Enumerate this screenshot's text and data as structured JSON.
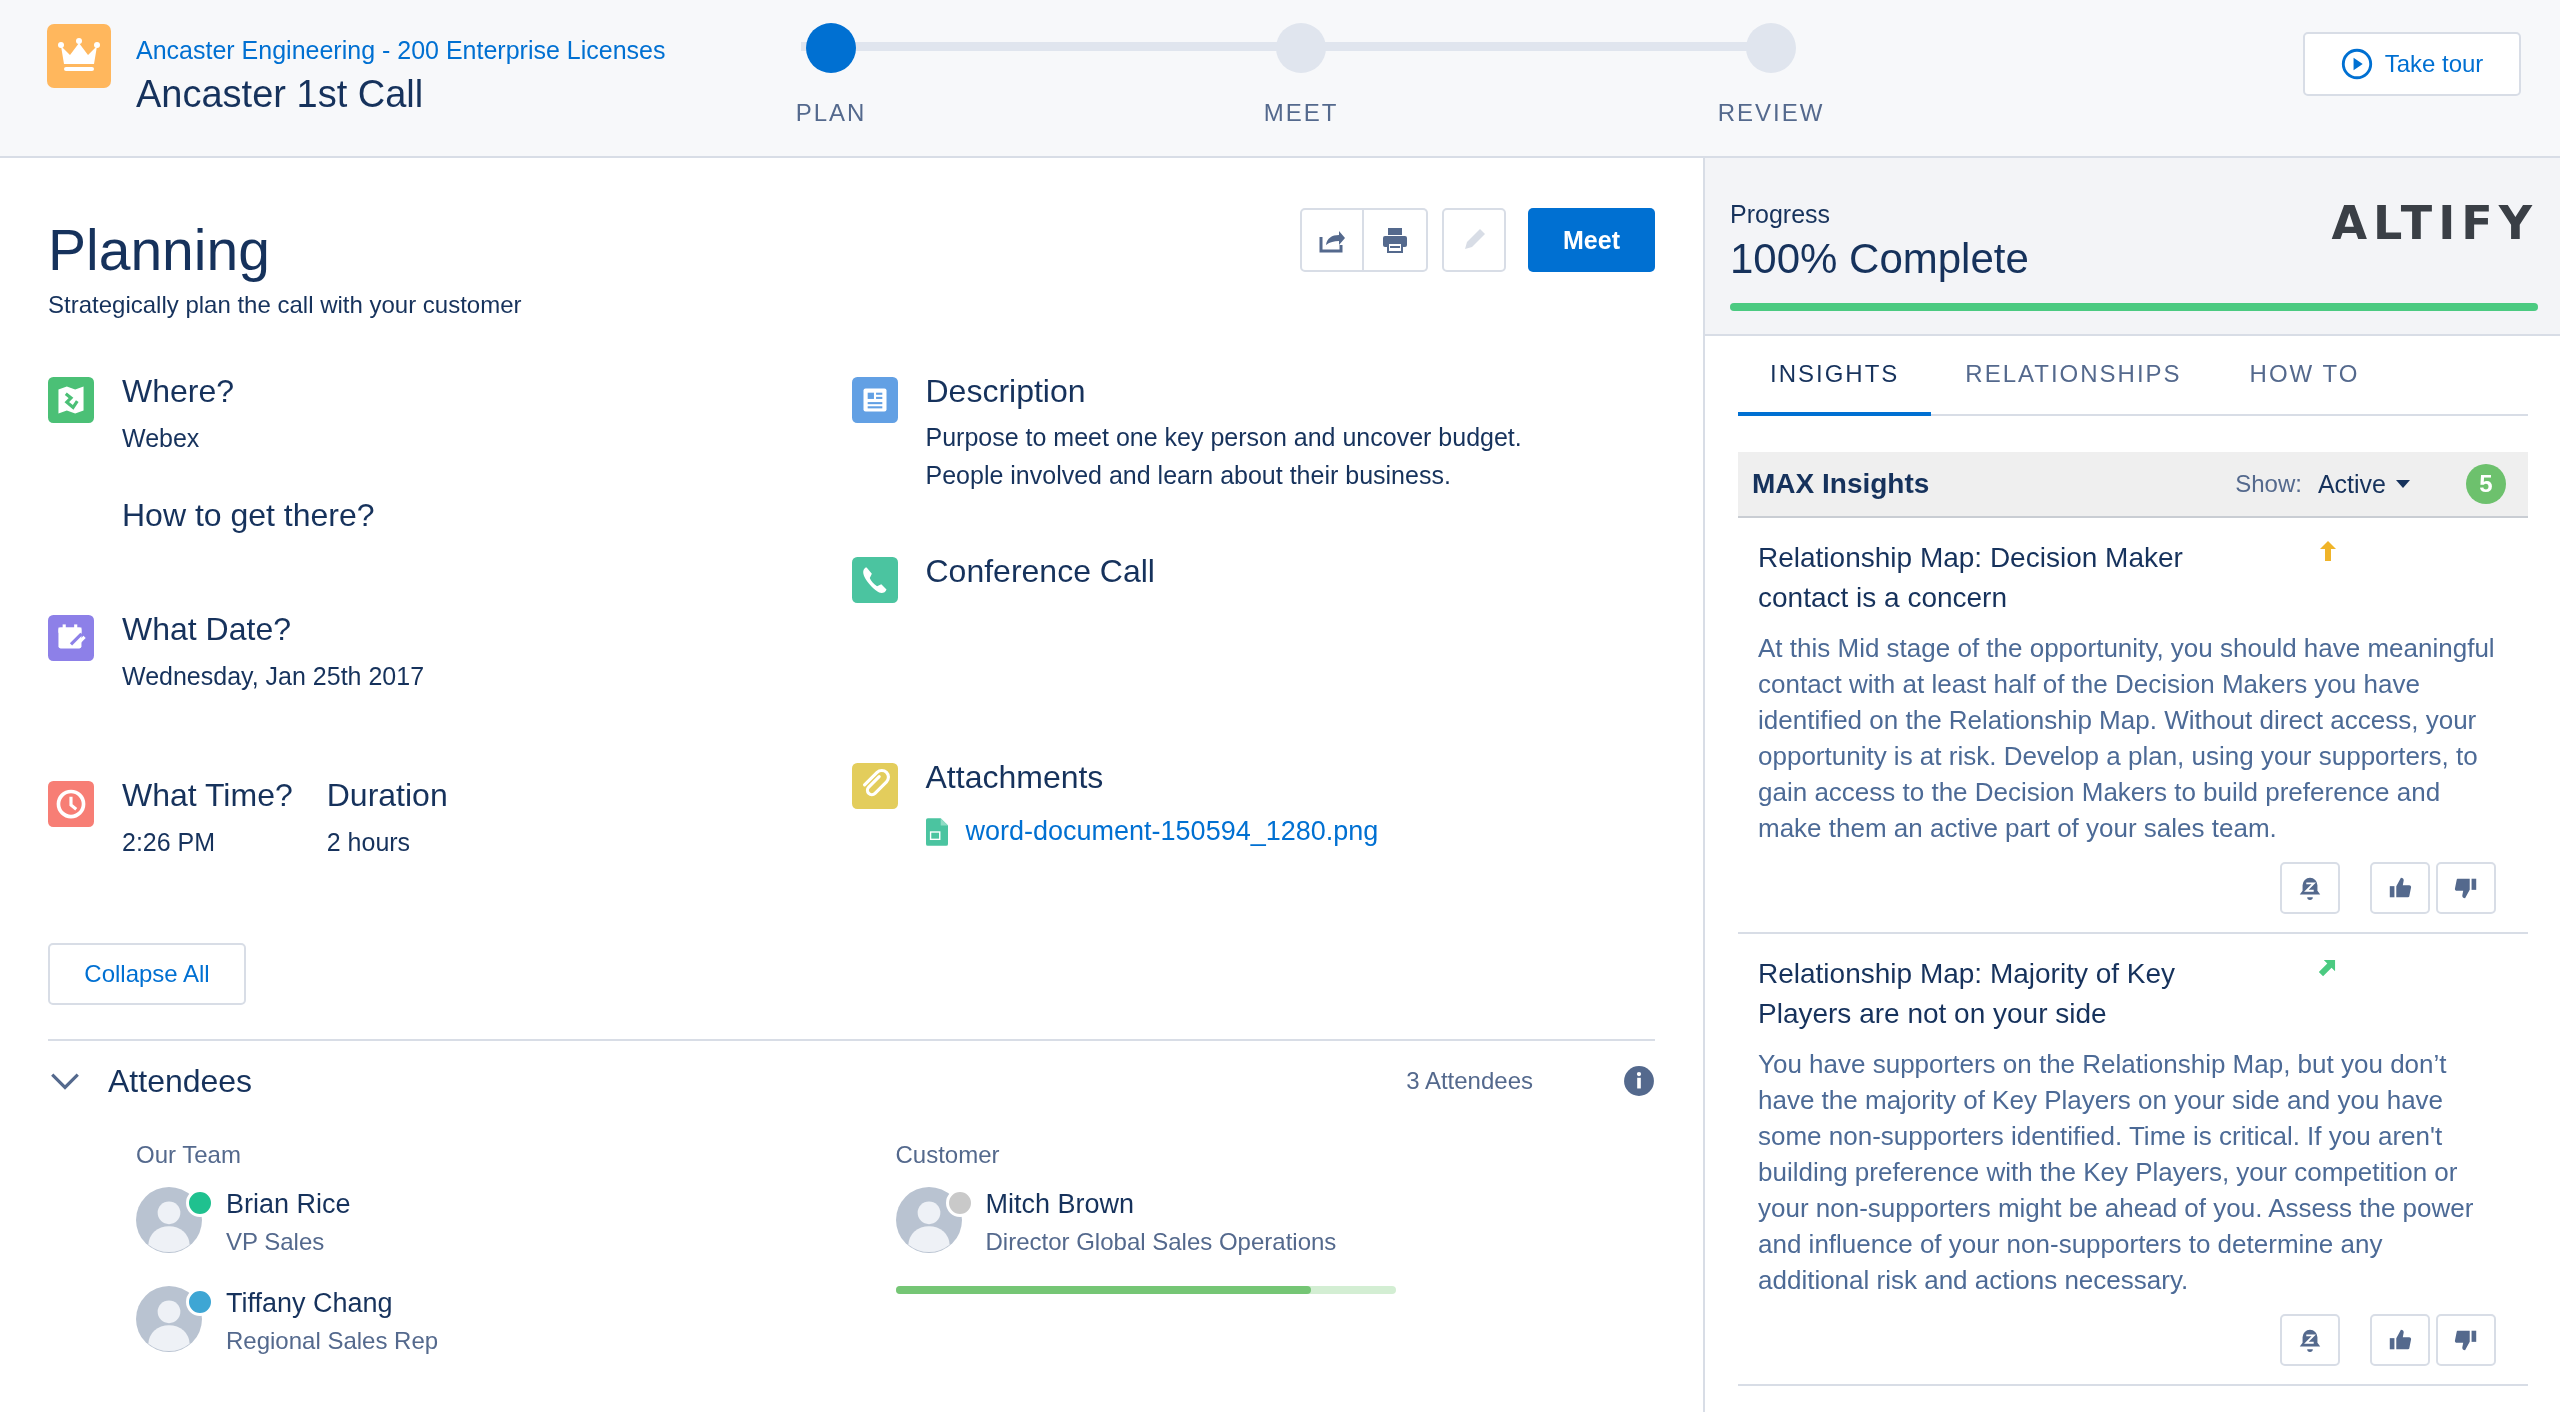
{
  "header": {
    "account_link": "Ancaster Engineering - 200 Enterprise Licenses",
    "title": "Ancaster 1st Call",
    "steps": [
      {
        "label": "PLAN",
        "selected": true
      },
      {
        "label": "MEET",
        "selected": false
      },
      {
        "label": "REVIEW",
        "selected": false
      }
    ],
    "tour_button": "Take tour"
  },
  "planning": {
    "title": "Planning",
    "subtitle": "Strategically plan the call with your customer",
    "meet_button": "Meet",
    "left_fields": [
      {
        "kind": "where",
        "heading": "Where?",
        "value": "Webex",
        "extra": "How to get there?"
      },
      {
        "kind": "date",
        "heading": "What Date?",
        "value": "Wednesday, Jan 25th 2017"
      },
      {
        "kind": "time",
        "heading": "What Time?",
        "value": "2:26 PM",
        "second_heading": "Duration",
        "second_value": "2 hours"
      }
    ],
    "right_fields": [
      {
        "kind": "description",
        "heading": "Description",
        "value": "Purpose to meet one key person and uncover budget.\nPeople involved and learn about their business."
      },
      {
        "kind": "call",
        "heading": "Conference Call"
      },
      {
        "kind": "attachments",
        "heading": "Attachments",
        "files": [
          "word-document-150594_1280.png"
        ]
      }
    ],
    "collapse_button": "Collapse All"
  },
  "attendees": {
    "title": "Attendees",
    "expanded": true,
    "count": "3 Attendees",
    "groups": [
      {
        "label": "Our Team",
        "people": [
          {
            "name": "Brian Rice",
            "role": "VP Sales",
            "color": "#1fc18f"
          },
          {
            "name": "Tiffany Chang",
            "role": "Regional Sales Rep",
            "color": "#3ea6d4"
          }
        ]
      },
      {
        "label": "Customer",
        "people": [
          {
            "name": "Mitch Brown",
            "role": "Director Global Sales Operations",
            "color": "#c9c9c9"
          }
        ],
        "level": 0.83
      }
    ]
  },
  "sidebar": {
    "progress_label": "Progress",
    "progress_value": "100% Complete",
    "level": 1,
    "logo": "ALTIFY",
    "tabs": [
      {
        "label": "INSIGHTS",
        "selected": true
      },
      {
        "label": "RELATIONSHIPS",
        "selected": false
      },
      {
        "label": "HOW TO",
        "selected": false
      }
    ],
    "insights": {
      "title": "MAX Insights",
      "show_label": "Show:",
      "filter": "Active",
      "count": "5",
      "items": [
        {
          "title": "Relationship Map: Decision Maker contact is a concern",
          "kind": "up",
          "color": "#f0b429",
          "body": "At this Mid stage of the opportunity, you should have meaningful contact with at least half of the Decision Makers you have identified on the Relationship Map. Without direct access, your opportunity is at risk. Develop a plan, using your supporters, to gain access to the Decision Makers to build preference and make them an active part of your sales team."
        },
        {
          "title": "Relationship Map: Majority of Key Players are not on your side",
          "kind": "up-right",
          "color": "#4bca81",
          "body": "You have supporters on the Relationship Map, but you don’t have the majority of Key Players on your side and you have some non-supporters identified. Time is critical. If you aren't building preference with the Key Players, your competition or your non-supporters might be ahead of you. Assess the power and influence of your non-supporters to determine any additional risk and actions necessary."
        }
      ]
    }
  }
}
